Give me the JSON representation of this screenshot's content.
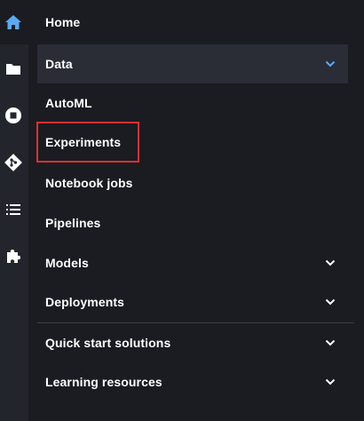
{
  "rail": {
    "icons": [
      "home-icon",
      "folder-icon",
      "stop-icon",
      "git-icon",
      "list-icon",
      "puzzle-icon"
    ],
    "active_color": "#5aa9f5",
    "icon_color": "#ffffff"
  },
  "nav": {
    "home": "Home",
    "data": "Data",
    "automl": "AutoML",
    "experiments": "Experiments",
    "notebook_jobs": "Notebook jobs",
    "pipelines": "Pipelines",
    "models": "Models",
    "deployments": "Deployments",
    "quick_start": "Quick start solutions",
    "learning": "Learning resources"
  },
  "colors": {
    "background": "#1a1c22",
    "selected_bg": "#2a2d36",
    "accent_chevron": "#5aa9f5",
    "highlight": "#e0302e"
  }
}
